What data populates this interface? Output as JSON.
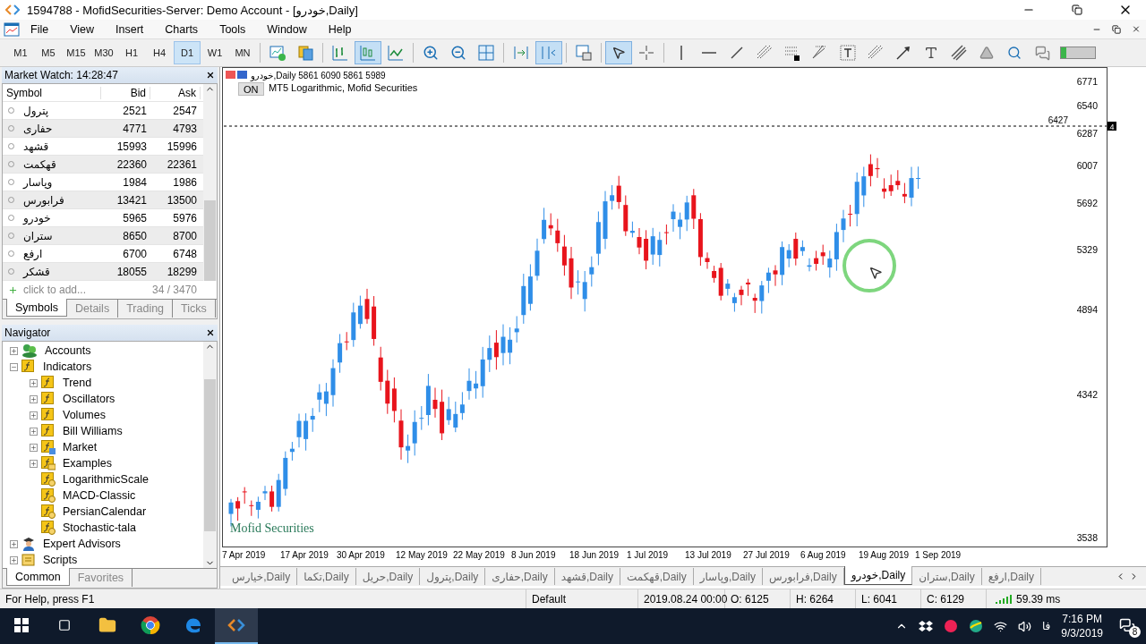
{
  "window": {
    "title": "1594788 - MofidSecurities-Server: Demo Account - [خودرو,Daily]"
  },
  "menu": [
    "File",
    "View",
    "Insert",
    "Charts",
    "Tools",
    "Window",
    "Help"
  ],
  "toolbar": {
    "timeframes": [
      {
        "label": "M1",
        "selected": false
      },
      {
        "label": "M5",
        "selected": false
      },
      {
        "label": "M15",
        "selected": false
      },
      {
        "label": "M30",
        "selected": false
      },
      {
        "label": "H1",
        "selected": false
      },
      {
        "label": "H4",
        "selected": false
      },
      {
        "label": "D1",
        "selected": true
      },
      {
        "label": "W1",
        "selected": false
      },
      {
        "label": "MN",
        "selected": false
      }
    ],
    "tool_groups": [
      [
        {
          "kind": "new-chart",
          "selected": false
        },
        {
          "kind": "profiles",
          "selected": false
        }
      ],
      [
        {
          "kind": "bars",
          "selected": false
        },
        {
          "kind": "candles",
          "selected": true
        },
        {
          "kind": "line",
          "selected": false
        }
      ],
      [
        {
          "kind": "zoom-in",
          "selected": false
        },
        {
          "kind": "zoom-out",
          "selected": false
        },
        {
          "kind": "tile",
          "selected": false
        }
      ],
      [
        {
          "kind": "shift",
          "selected": false
        },
        {
          "kind": "autoscroll",
          "selected": true
        }
      ],
      [
        {
          "kind": "templates",
          "selected": false
        }
      ],
      [
        {
          "kind": "cursor",
          "selected": true
        },
        {
          "kind": "crosshair",
          "selected": false
        }
      ],
      [
        {
          "kind": "vline",
          "selected": false
        },
        {
          "kind": "hline",
          "selected": false
        },
        {
          "kind": "trendline",
          "selected": false
        },
        {
          "kind": "fibo",
          "selected": false
        },
        {
          "kind": "grid",
          "selected": false
        },
        {
          "kind": "fan",
          "selected": false
        },
        {
          "kind": "textbox",
          "selected": false
        },
        {
          "kind": "fibo",
          "selected": false
        },
        {
          "kind": "arrow",
          "selected": false
        },
        {
          "kind": "text",
          "selected": false
        },
        {
          "kind": "channel",
          "selected": false
        },
        {
          "kind": "triangle",
          "selected": false
        },
        {
          "kind": "search",
          "selected": false
        },
        {
          "kind": "chat",
          "selected": false
        }
      ]
    ],
    "meter": {
      "level": 0.15
    }
  },
  "market_watch": {
    "title": "Market Watch: 14:28:47",
    "columns": [
      "Symbol",
      "Bid",
      "Ask"
    ],
    "rows": [
      {
        "symbol": "پترول",
        "bid": "2521",
        "ask": "2547"
      },
      {
        "symbol": "حفاری",
        "bid": "4771",
        "ask": "4793"
      },
      {
        "symbol": "قشهد",
        "bid": "15993",
        "ask": "15996"
      },
      {
        "symbol": "قهکمت",
        "bid": "22360",
        "ask": "22361"
      },
      {
        "symbol": "وپاسار",
        "bid": "1984",
        "ask": "1986"
      },
      {
        "symbol": "فرابورس",
        "bid": "13421",
        "ask": "13500"
      },
      {
        "symbol": "خودرو",
        "bid": "5965",
        "ask": "5976"
      },
      {
        "symbol": "ستران",
        "bid": "8650",
        "ask": "8700"
      },
      {
        "symbol": "ارفع",
        "bid": "6700",
        "ask": "6748"
      },
      {
        "symbol": "قشکر",
        "bid": "18055",
        "ask": "18299"
      }
    ],
    "add_placeholder": "click to add...",
    "count": "34 / 3470",
    "tabs": [
      {
        "label": "Symbols",
        "selected": true
      },
      {
        "label": "Details",
        "selected": false
      },
      {
        "label": "Trading",
        "selected": false
      },
      {
        "label": "Ticks",
        "selected": false
      }
    ]
  },
  "navigator": {
    "title": "Navigator",
    "tree": [
      {
        "label": "Accounts",
        "kind": "accounts",
        "expanded": false
      },
      {
        "label": "Indicators",
        "kind": "indicators",
        "expanded": true,
        "children": [
          {
            "label": "Trend",
            "kind": "folder",
            "expanded": false
          },
          {
            "label": "Oscillators",
            "kind": "folder",
            "expanded": false
          },
          {
            "label": "Volumes",
            "kind": "folder",
            "expanded": false
          },
          {
            "label": "Bill Williams",
            "kind": "folder",
            "expanded": false
          },
          {
            "label": "Market",
            "kind": "market",
            "expanded": false
          },
          {
            "label": "Examples",
            "kind": "examples",
            "expanded": false
          },
          {
            "label": "LogarithmicScale",
            "kind": "custom"
          },
          {
            "label": "MACD-Classic",
            "kind": "custom"
          },
          {
            "label": "PersianCalendar",
            "kind": "custom"
          },
          {
            "label": "Stochastic-tala",
            "kind": "custom"
          }
        ]
      },
      {
        "label": "Expert Advisors",
        "kind": "experts",
        "expanded": false
      },
      {
        "label": "Scripts",
        "kind": "scripts",
        "expanded": false
      }
    ],
    "tabs": [
      {
        "label": "Common",
        "selected": true
      },
      {
        "label": "Favorites",
        "selected": false
      }
    ]
  },
  "chart": {
    "header": "خودرو,Daily  5861 6090 5861 5989",
    "indicator_button": "ON",
    "indicator": "MT5 Logarithmic, Mofid Securities",
    "price_line": "6427",
    "price_line_tag": "4",
    "brand": "Mofid Securities",
    "price_axis": [
      "6771",
      "6540",
      "6287",
      "6007",
      "5692",
      "5329",
      "4894",
      "4342",
      "3538"
    ],
    "date_axis": [
      "7 Apr 2019",
      "17 Apr 2019",
      "30 Apr 2019",
      "12 May 2019",
      "22 May 2019",
      "8 Jun 2019",
      "18 Jun 2019",
      "1 Jul 2019",
      "13 Jul 2019",
      "27 Jul 2019",
      "6 Aug 2019",
      "19 Aug 2019",
      "1 Sep 2019"
    ]
  },
  "chart_tabs": [
    {
      "label": "خیارس,Daily",
      "selected": false
    },
    {
      "label": "تکما,Daily",
      "selected": false
    },
    {
      "label": "حریل,Daily",
      "selected": false
    },
    {
      "label": "پترول,Daily",
      "selected": false
    },
    {
      "label": "حفاری,Daily",
      "selected": false
    },
    {
      "label": "قشهد,Daily",
      "selected": false
    },
    {
      "label": "قهکمت,Daily",
      "selected": false
    },
    {
      "label": "وپاسار,Daily",
      "selected": false
    },
    {
      "label": "فرابورس,Daily",
      "selected": false
    },
    {
      "label": "خودرو,Daily",
      "selected": true
    },
    {
      "label": "ستران,Daily",
      "selected": false
    },
    {
      "label": "ارفع,Daily",
      "selected": false
    }
  ],
  "status_bar": {
    "help": "For Help, press F1",
    "profile": "Default",
    "time": "2019.08.24 00:00",
    "open": "O: 6125",
    "high": "H: 6264",
    "low": "L: 6041",
    "close": "C: 6129",
    "ping": "59.39 ms"
  },
  "taskbar": {
    "apps": [
      {
        "kind": "explorer",
        "selected": false
      },
      {
        "kind": "chrome",
        "selected": false
      },
      {
        "kind": "edge",
        "selected": false
      },
      {
        "kind": "terminal",
        "selected": true
      }
    ],
    "language": "فا",
    "clock": "7:16 PM",
    "date": "9/3/2019",
    "notifications": "8"
  }
}
